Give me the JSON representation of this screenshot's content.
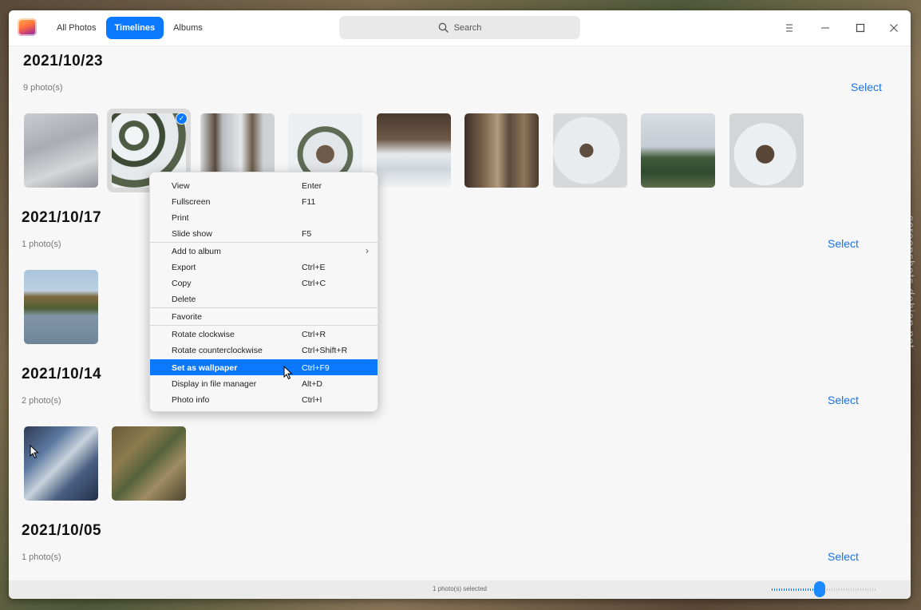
{
  "header": {
    "tabs": [
      "All Photos",
      "Timelines",
      "Albums"
    ],
    "active_tab": "Timelines",
    "search_placeholder": "Search",
    "menu_icon": "hamburger-icon",
    "minimize_icon": "minimize-icon",
    "maximize_icon": "maximize-icon",
    "close_icon": "close-icon"
  },
  "sections": [
    {
      "date": "2021/10/23",
      "count": "9 photo(s)",
      "select": "Select"
    },
    {
      "date": "2021/10/17",
      "count": "1 photo(s)",
      "select": "Select"
    },
    {
      "date": "2021/10/14",
      "count": "2 photo(s)",
      "select": "Select"
    },
    {
      "date": "2021/10/05",
      "count": "1 photo(s)",
      "select": "Select"
    }
  ],
  "status": {
    "text": "1 photo(s) selected",
    "zoom_fraction": 0.45
  },
  "context_menu": {
    "items": [
      {
        "label": "View",
        "shortcut": "Enter"
      },
      {
        "label": "Fullscreen",
        "shortcut": "F11"
      },
      {
        "label": "Print",
        "shortcut": ""
      },
      {
        "label": "Slide show",
        "shortcut": "F5"
      },
      {
        "label": "Add to album",
        "shortcut": ""
      },
      {
        "label": "Export",
        "shortcut": "Ctrl+E"
      },
      {
        "label": "Copy",
        "shortcut": "Ctrl+C"
      },
      {
        "label": "Delete",
        "shortcut": ""
      },
      {
        "label": "Favorite",
        "shortcut": ""
      },
      {
        "label": "Rotate clockwise",
        "shortcut": "Ctrl+R"
      },
      {
        "label": "Rotate counterclockwise",
        "shortcut": "Ctrl+Shift+R"
      },
      {
        "label": "Set as wallpaper",
        "shortcut": "Ctrl+F9"
      },
      {
        "label": "Display in file manager",
        "shortcut": "Alt+D"
      },
      {
        "label": "Photo info",
        "shortcut": "Ctrl+I"
      }
    ],
    "highlighted": "Set as wallpaper"
  },
  "watermark": "screenshots.debian.net",
  "colors": {
    "accent": "#0a79ff",
    "link": "#1a73e8"
  }
}
